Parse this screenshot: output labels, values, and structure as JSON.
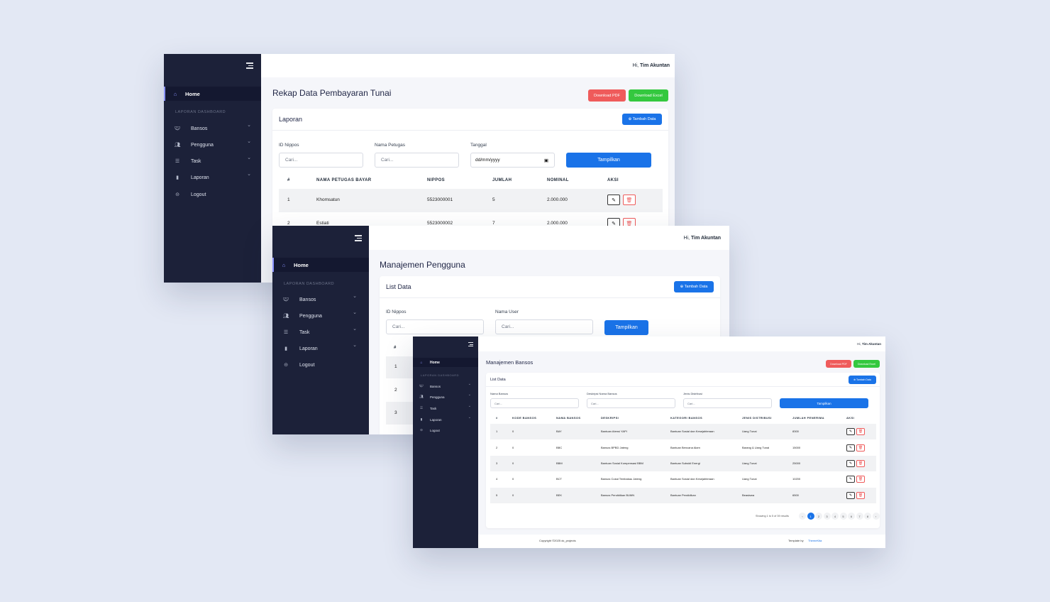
{
  "user": {
    "greeting": "Hi,",
    "name": "Tim Akuntan"
  },
  "sidebar": {
    "home": "Home",
    "section": "LAPORAN DASHBOARD",
    "items": [
      {
        "label": "Bansos",
        "icon": "handshake-icon",
        "chevron": "⌄"
      },
      {
        "label": "Pengguna",
        "icon": "users-icon",
        "chevron": "⌄"
      },
      {
        "label": "Task",
        "icon": "list-icon",
        "chevron": "⌄"
      },
      {
        "label": "Laporan",
        "icon": "file-icon",
        "chevron": "⌄"
      },
      {
        "label": "Logout",
        "icon": "logout-icon",
        "chevron": ""
      }
    ]
  },
  "win1": {
    "title": "Rekap Data Pembayaran Tunai",
    "download_pdf": "Download PDF",
    "download_excel": "Download Excel",
    "card_title": "Laporan",
    "add": "⊕ Tambah Data",
    "filters": [
      {
        "label": "ID Nippos",
        "placeholder": "Cari..."
      },
      {
        "label": "Nama Petugas",
        "placeholder": "Cari..."
      },
      {
        "label": "Tanggal",
        "placeholder": "dd/mm/yyyy"
      }
    ],
    "show": "Tampilkan",
    "columns": [
      "#",
      "NAMA PETUGAS BAYAR",
      "NIPPOS",
      "JUMLAH",
      "NOMINAL",
      "AKSI"
    ],
    "rows": [
      [
        "1",
        "Khomsatun",
        "5523000001",
        "5",
        "2.000.000"
      ],
      [
        "2",
        "Estiati",
        "5523000002",
        "7",
        "2.000.000"
      ]
    ]
  },
  "win2": {
    "title": "Manajemen Pengguna",
    "card_title": "List Data",
    "add": "⊕ Tambah Data",
    "filters": [
      {
        "label": "ID Nippos",
        "placeholder": "Cari..."
      },
      {
        "label": "Nama User",
        "placeholder": "Cari..."
      }
    ],
    "show": "Tampilkan",
    "columns": [
      "#"
    ],
    "rows": [
      "1",
      "2",
      "3"
    ]
  },
  "win3": {
    "title": "Manajemen Bansos",
    "download_pdf": "Download PDF",
    "download_excel": "Download Excel",
    "card_title": "List Data",
    "add": "⊕ Tambah Data",
    "filters": [
      {
        "label": "Nama Bansos",
        "placeholder": "Cari..."
      },
      {
        "label": "Deskripsi Nama Bansos",
        "placeholder": "Cari..."
      },
      {
        "label": "Jenis Distribusi",
        "placeholder": "Cari..."
      }
    ],
    "show": "Tampilkan",
    "columns": [
      "#",
      "KODE BANSOS",
      "NAMA BANSOS",
      "DESKRIPSI",
      "KATEGORI BANSOS",
      "JENIS DISTRIBUSI",
      "JUMLAH PENERIMA",
      "AKSI"
    ],
    "rows": [
      [
        "1",
        "0",
        "BAY",
        "Bantuan Atensi YAPI",
        "Bantuan Sosial dan Kesejahteraan",
        "Uang Tunai",
        "8300"
      ],
      [
        "2",
        "0",
        "BBC",
        "Bansos BPBD Jateng",
        "Bantuan Bencana Alam",
        "Barang & Uang Tunai",
        "15000"
      ],
      [
        "3",
        "0",
        "BBM",
        "Bantuan Sosial Kompensasi BBM",
        "Bantuan Subsidi Energi",
        "Uang Tunai",
        "25000"
      ],
      [
        "4",
        "0",
        "BCT",
        "Bansos Cukai Tembakau Jateng",
        "Bantuan Sosial dan Kesejahteraan",
        "Uang Tunai",
        "10200"
      ],
      [
        "5",
        "0",
        "BEK",
        "Bansos Pendidikan BUMN",
        "Bantuan Pendidikan",
        "Beasiswa",
        "6500"
      ]
    ],
    "showing": "Showing 1 to 5 of 39 results",
    "pages": [
      "‹",
      "1",
      "2",
      "3",
      "4",
      "5",
      "6",
      "7",
      "8",
      "›"
    ],
    "footer_copy": "Copyright ©2025 dc_projects",
    "footer_tpl": "Template by",
    "footer_link": "ThemeKita"
  }
}
